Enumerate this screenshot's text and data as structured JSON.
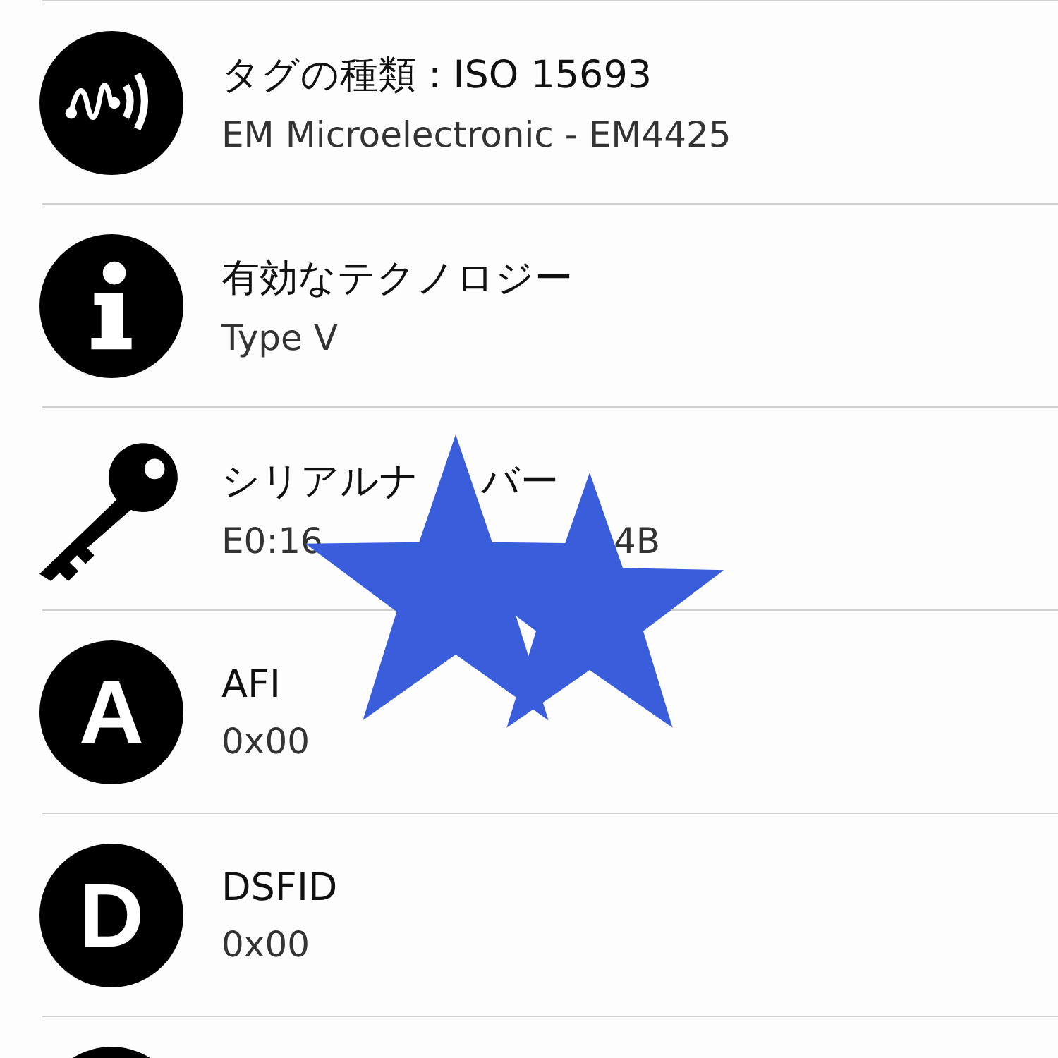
{
  "rows": [
    {
      "kind": "nfc",
      "title": "タグの種類 : ISO 15693",
      "subtitle": "EM Microelectronic - EM4425"
    },
    {
      "kind": "info",
      "title": "有効なテクノロジー",
      "subtitle": "Type V"
    },
    {
      "kind": "key",
      "title_parts": [
        "シリアルナ",
        "バー"
      ],
      "subtitle_parts": [
        "E0:16",
        "4B"
      ]
    },
    {
      "kind": "letter",
      "icon_letter": "A",
      "title": "AFI",
      "subtitle": "0x00"
    },
    {
      "kind": "letter",
      "icon_letter": "D",
      "title": "DSFID",
      "subtitle": "0x00"
    },
    {
      "kind": "blank"
    }
  ],
  "overlay": {
    "kind": "stars",
    "color": "#3a5ddb"
  }
}
